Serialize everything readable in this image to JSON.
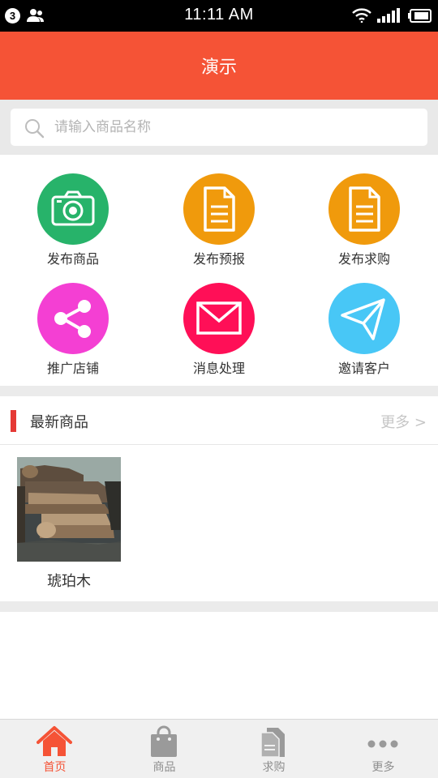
{
  "status_bar": {
    "notification_count": "3",
    "time": "11:11 AM",
    "icons": [
      "contacts-icon",
      "wifi-icon",
      "signal-icon",
      "battery-icon"
    ]
  },
  "header": {
    "title": "演示"
  },
  "search": {
    "placeholder": "请输入商品名称",
    "value": "",
    "icon": "search-icon"
  },
  "actions": [
    {
      "label": "发布商品",
      "icon": "camera-icon",
      "color": "#27b36a"
    },
    {
      "label": "发布预报",
      "icon": "document-icon",
      "color": "#f09a0c"
    },
    {
      "label": "发布求购",
      "icon": "document-icon",
      "color": "#f09a0c"
    },
    {
      "label": "推广店铺",
      "icon": "share-icon",
      "color": "#f43fd3"
    },
    {
      "label": "消息处理",
      "icon": "mail-icon",
      "color": "#ff0f57"
    },
    {
      "label": "邀请客户",
      "icon": "send-icon",
      "color": "#48c7f6"
    }
  ],
  "latest": {
    "title": "最新商品",
    "more": "更多 >",
    "products": [
      {
        "name": "琥珀木",
        "image": "stacked timber logs"
      }
    ]
  },
  "tabbar": {
    "tabs": [
      {
        "label": "首页",
        "icon": "home-icon",
        "active": true
      },
      {
        "label": "商品",
        "icon": "shopping-bag-icon",
        "active": false
      },
      {
        "label": "求购",
        "icon": "documents-icon",
        "active": false
      },
      {
        "label": "更多",
        "icon": "more-dots-icon",
        "active": false
      }
    ]
  },
  "colors": {
    "brand": "#f55336",
    "section_marker": "#e53935",
    "background": "#ebebeb"
  }
}
